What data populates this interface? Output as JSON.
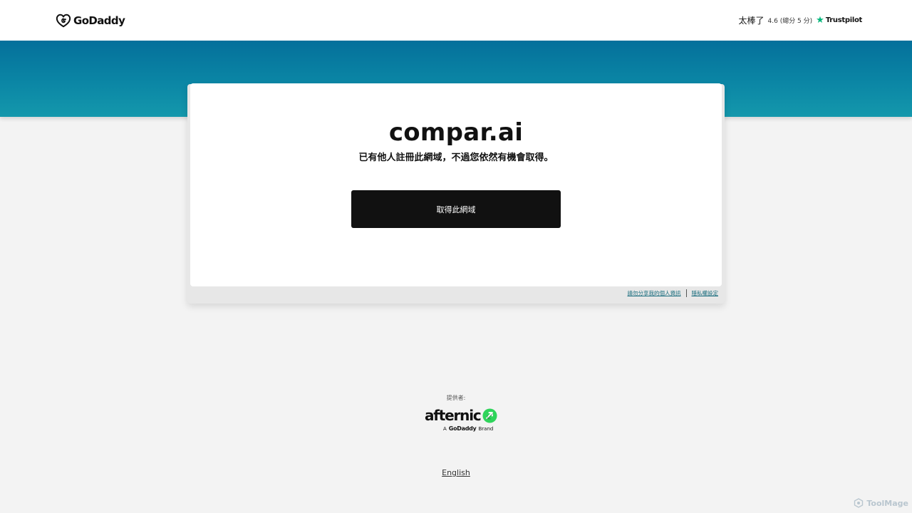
{
  "header": {
    "brand": "GoDaddy",
    "rating": {
      "label": "太棒了",
      "score": "4.6 (總分 5 分)",
      "provider": "Trustpilot"
    }
  },
  "main": {
    "domain": "compar.ai",
    "message": "已有他人註冊此網域，不過您依然有機會取得。",
    "cta_label": "取得此網域"
  },
  "card_links": {
    "do_not_share": "請勿分享我的個人資訊",
    "privacy_settings": "隱私權設定"
  },
  "footer": {
    "provided_by": "提供者:",
    "partner": "afternic",
    "partner_tagline_prefix": "A",
    "partner_tagline_brand": "GoDaddy",
    "partner_tagline_suffix": "Brand",
    "language": "English"
  },
  "watermark": "ToolMage",
  "colors": {
    "band": "#0b86a5",
    "cta": "#111111",
    "trustpilot_star": "#00b67a",
    "afternic_green": "#2fd45b"
  }
}
